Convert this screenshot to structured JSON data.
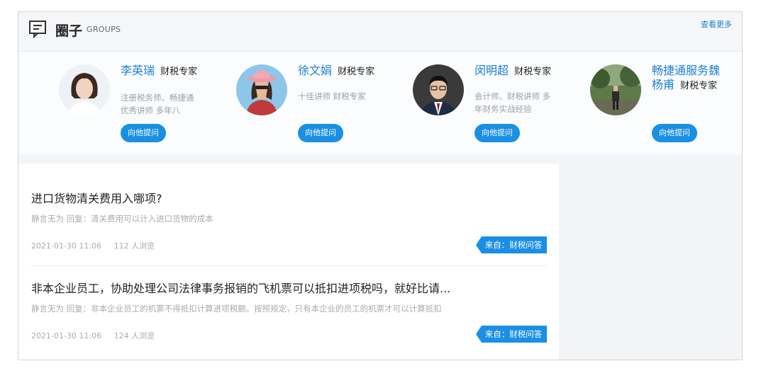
{
  "header": {
    "title": "圈子",
    "subtitle": "GROUPS",
    "more_label": "查看更多"
  },
  "experts": [
    {
      "name": "李英瑞",
      "role": "财税专家",
      "desc": "注册税务师、畅捷通优秀讲师 多年八",
      "button": "向他提问"
    },
    {
      "name": "徐文娟",
      "role": "财税专家",
      "desc": "十佳讲师 财税专家",
      "button": "向他提问"
    },
    {
      "name": "闵明超",
      "role": "财税专家",
      "desc": "会计师、财税讲师 多年财务实战经验",
      "button": "向他提问"
    },
    {
      "name": "畅捷通服务魏杨甫",
      "role": "财税专家",
      "desc": "",
      "button": "向他提问"
    }
  ],
  "questions": [
    {
      "title": "进口货物清关费用入哪项?",
      "reply": "静言无为 回复：清关费用可以计入进口货物的成本",
      "date": "2021-01-30 11:06",
      "views": "112 人浏览",
      "tag": "来自：财税问答"
    },
    {
      "title": "非本企业员工，协助处理公司法律事务报销的飞机票可以抵扣进项税吗，就好比请...",
      "reply": "静言无为 回复：非本企业员工的机票不得抵扣计算进项税额。按照规定，只有本企业的员工的机票才可以计算抵扣",
      "date": "2021-01-30 11:06",
      "views": "124 人浏览",
      "tag": "来自：财税问答"
    }
  ],
  "colors": {
    "accent": "#1a8fe3",
    "link": "#1a7fd4"
  }
}
